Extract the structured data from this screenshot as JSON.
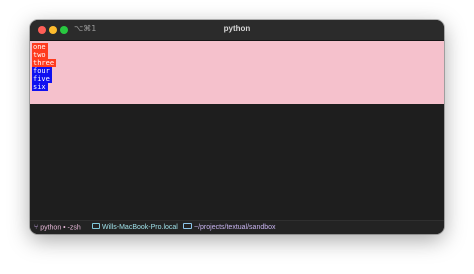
{
  "window": {
    "title": "python",
    "shortcut": "⌥⌘1"
  },
  "terminal": {
    "pane_color": "#f5c1cc",
    "lines": [
      {
        "text": "one",
        "bg": "#ff3b1f"
      },
      {
        "text": "two",
        "bg": "#ff3b1f"
      },
      {
        "text": "three",
        "bg": "#ff3b1f"
      },
      {
        "text": "four",
        "bg": "#1010f0"
      },
      {
        "text": "five",
        "bg": "#1010f0"
      },
      {
        "text": "six",
        "bg": "#1010f0"
      }
    ]
  },
  "statusbar": {
    "process": "python • -zsh",
    "host": "Wills-MacBook-Pro.local",
    "path": "~/projects/textual/sandbox"
  },
  "icons": {
    "branch": "branch-icon",
    "monitor": "monitor-icon",
    "folder": "folder-icon"
  }
}
